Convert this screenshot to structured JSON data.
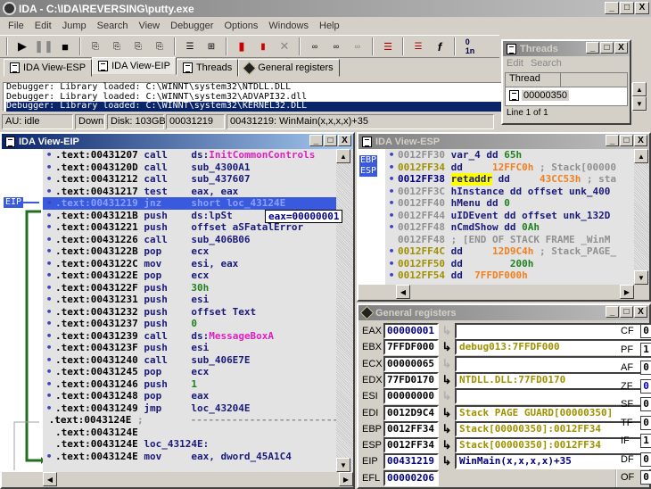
{
  "window": {
    "title": "IDA - C:\\IDA\\REVERSING\\putty.exe",
    "minimize": "_",
    "maximize": "□",
    "close": "X"
  },
  "menu": [
    "File",
    "Edit",
    "Jump",
    "Search",
    "View",
    "Debugger",
    "Options",
    "Windows",
    "Help"
  ],
  "toolbar": {
    "icons": [
      "run-icon",
      "pause-icon",
      "stop-icon",
      "step-into-icon",
      "step-over-icon",
      "run-to-cursor-icon",
      "step-out-icon",
      "breakpoint-list-icon",
      "breakpoint-tree-icon",
      "thread-icon",
      "module-icon",
      "delete-icon",
      "trace-icon",
      "trace2-icon",
      "trace3-icon",
      "stack-trace-icon",
      "func-list-icon",
      "func-icon",
      "names-icon"
    ]
  },
  "tabs": [
    {
      "label": "IDA View-ESP",
      "active": false
    },
    {
      "label": "IDA View-EIP",
      "active": true
    },
    {
      "label": "Threads",
      "active": false
    },
    {
      "label": "General registers",
      "active": false
    }
  ],
  "output": [
    "Debugger: Library loaded: C:\\WINNT\\system32\\NTDLL.DLL",
    "Debugger: Library loaded: C:\\WINNT\\system32\\ADVAPI32.dll",
    "Debugger: Library loaded: C:\\WINNT\\system32\\KERNEL32.DLL"
  ],
  "status": {
    "au": "AU: idle",
    "dir": "Down",
    "disk": "Disk: 103GB",
    "offset": "00031219",
    "location": "00431219: WinMain(x,x,x,x)+35"
  },
  "threads": {
    "title": "Threads",
    "menu": [
      "Edit",
      "Search"
    ],
    "column": "Thread",
    "rows": [
      "00000350"
    ],
    "footer": "Line 1 of 1"
  },
  "eip_view": {
    "title": "IDA View-EIP",
    "eip_label": "EIP",
    "tooltip": "eax=00000001",
    "rows": [
      {
        "addr": ".text:00431207",
        "mn": "call",
        "op": "ds:",
        "op2": "InitCommonControls",
        "op2c": "pink"
      },
      {
        "addr": ".text:0043120D",
        "mn": "call",
        "op": "sub_4300A1"
      },
      {
        "addr": ".text:00431212",
        "mn": "call",
        "op": "sub_437607"
      },
      {
        "addr": ".text:00431217",
        "mn": "test",
        "op": "eax, eax"
      },
      {
        "addr": ".text:00431219",
        "mn": "jnz",
        "op": "short loc_43124E",
        "hl": true
      },
      {
        "addr": ".text:0043121B",
        "mn": "push",
        "op": "ds:lpSt"
      },
      {
        "addr": ".text:00431221",
        "mn": "push",
        "op": "offset aSFatalError"
      },
      {
        "addr": ".text:00431226",
        "mn": "call",
        "op": "sub_406B06"
      },
      {
        "addr": ".text:0043122B",
        "mn": "pop",
        "op": "ecx"
      },
      {
        "addr": ".text:0043122C",
        "mn": "mov",
        "op": "esi, eax"
      },
      {
        "addr": ".text:0043122E",
        "mn": "pop",
        "op": "ecx"
      },
      {
        "addr": ".text:0043122F",
        "mn": "push",
        "op": "",
        "op2": "30h",
        "op2c": "green"
      },
      {
        "addr": ".text:00431231",
        "mn": "push",
        "op": "esi"
      },
      {
        "addr": ".text:00431232",
        "mn": "push",
        "op": "offset Text"
      },
      {
        "addr": ".text:00431237",
        "mn": "push",
        "op": "",
        "op2": "0",
        "op2c": "green"
      },
      {
        "addr": ".text:00431239",
        "mn": "call",
        "op": "ds:",
        "op2": "MessageBoxA",
        "op2c": "pink"
      },
      {
        "addr": ".text:0043123F",
        "mn": "push",
        "op": "esi"
      },
      {
        "addr": ".text:00431240",
        "mn": "call",
        "op": "sub_406E7E"
      },
      {
        "addr": ".text:00431245",
        "mn": "pop",
        "op": "ecx"
      },
      {
        "addr": ".text:00431246",
        "mn": "push",
        "op": "",
        "op2": "1",
        "op2c": "green"
      },
      {
        "addr": ".text:00431248",
        "mn": "pop",
        "op": "eax"
      },
      {
        "addr": ".text:00431249",
        "mn": "jmp",
        "op": "loc_43204E"
      },
      {
        "addr": ".text:0043124E",
        "mn": ";",
        "op": " ---------------------------",
        "nodot": true,
        "gray": true
      },
      {
        "addr": ".text:0043124E",
        "mn": "",
        "op": "",
        "nodot": true
      },
      {
        "addr": ".text:0043124E",
        "mn": "loc_43124E:",
        "op": "",
        "nodot": true
      },
      {
        "addr": ".text:0043124E",
        "mn": "mov",
        "op": "eax, dword_45A1C4"
      }
    ]
  },
  "esp_view": {
    "title": "IDA View-ESP",
    "ebp_label": "EBP",
    "esp_label": "ESP",
    "rows": [
      {
        "addr": "0012FF30",
        "ac": "gray",
        "t": "var_4 dd ",
        "v": "65h",
        "vc": "green",
        "r": ""
      },
      {
        "addr": "0012FF34",
        "ac": "olive",
        "t": "dd     ",
        "v": "12FFC0h",
        "vc": "orange",
        "r": " ; Stack[00000"
      },
      {
        "addr": "0012FF38",
        "ac": "navy",
        "t": "retaddr",
        "hl": true,
        "t2": " dd     ",
        "v": "43CC53h",
        "vc": "orange",
        "r": " ; sta"
      },
      {
        "addr": "0012FF3C",
        "ac": "gray",
        "t": "hInstance dd offset unk_400",
        "v": "",
        "r": ""
      },
      {
        "addr": "0012FF40",
        "ac": "gray",
        "t": "hMenu dd ",
        "v": "0",
        "vc": "green",
        "r": ""
      },
      {
        "addr": "0012FF44",
        "ac": "gray",
        "t": "uIDEvent dd offset unk_132D",
        "v": "",
        "r": ""
      },
      {
        "addr": "0012FF48",
        "ac": "gray",
        "t": "nCmdShow dd ",
        "v": "0Ah",
        "vc": "green",
        "r": ""
      },
      {
        "addr": "0012FF48",
        "ac": "gray",
        "t": "",
        "v": "",
        "r": "; [END OF STACK FRAME _WinM",
        "nodot": true
      },
      {
        "addr": "0012FF4C",
        "ac": "olive",
        "t": "dd     ",
        "v": "12D9C4h",
        "vc": "orange",
        "r": " ; Stack_PAGE_"
      },
      {
        "addr": "0012FF50",
        "ac": "olive",
        "t": "dd        ",
        "v": "200h",
        "vc": "green",
        "r": ""
      },
      {
        "addr": "0012FF54",
        "ac": "olive",
        "t": "dd  ",
        "v": "7FFDF000h",
        "vc": "orange",
        "r": ""
      }
    ]
  },
  "registers": {
    "title": "General registers",
    "rows": [
      {
        "name": "EAX",
        "value": "00000001",
        "vc": "navy",
        "ptr": false,
        "desc": ""
      },
      {
        "name": "EBX",
        "value": "7FFDF000",
        "vc": "black",
        "ptr": true,
        "desc": "debug013:7FFDF000"
      },
      {
        "name": "ECX",
        "value": "00000065",
        "vc": "black",
        "ptr": false,
        "desc": ""
      },
      {
        "name": "EDX",
        "value": "77FD0170",
        "vc": "black",
        "ptr": true,
        "desc": "NTDLL.DLL:77FD0170"
      },
      {
        "name": "ESI",
        "value": "00000000",
        "vc": "black",
        "ptr": false,
        "desc": ""
      },
      {
        "name": "EDI",
        "value": "0012D9C4",
        "vc": "black",
        "ptr": true,
        "desc": "Stack PAGE GUARD[00000350]"
      },
      {
        "name": "EBP",
        "value": "0012FF34",
        "vc": "black",
        "ptr": true,
        "desc": "Stack[00000350]:0012FF34"
      },
      {
        "name": "ESP",
        "value": "0012FF34",
        "vc": "black",
        "ptr": true,
        "desc": "Stack[00000350]:0012FF34"
      },
      {
        "name": "EIP",
        "value": "00431219",
        "vc": "navy",
        "ptr": true,
        "desc": "WinMain(x,x,x,x)+35",
        "dc": "navy"
      },
      {
        "name": "EFL",
        "value": "00000206",
        "vc": "navy",
        "noarrow": true
      }
    ],
    "flags": [
      {
        "name": "CF",
        "value": "0"
      },
      {
        "name": "PF",
        "value": "1"
      },
      {
        "name": "AF",
        "value": "0"
      },
      {
        "name": "ZF",
        "value": "0",
        "changed": true
      },
      {
        "name": "SF",
        "value": "0"
      },
      {
        "name": "TF",
        "value": "0"
      },
      {
        "name": "IF",
        "value": "1"
      },
      {
        "name": "DF",
        "value": "0"
      },
      {
        "name": "OF",
        "value": "0"
      }
    ]
  }
}
